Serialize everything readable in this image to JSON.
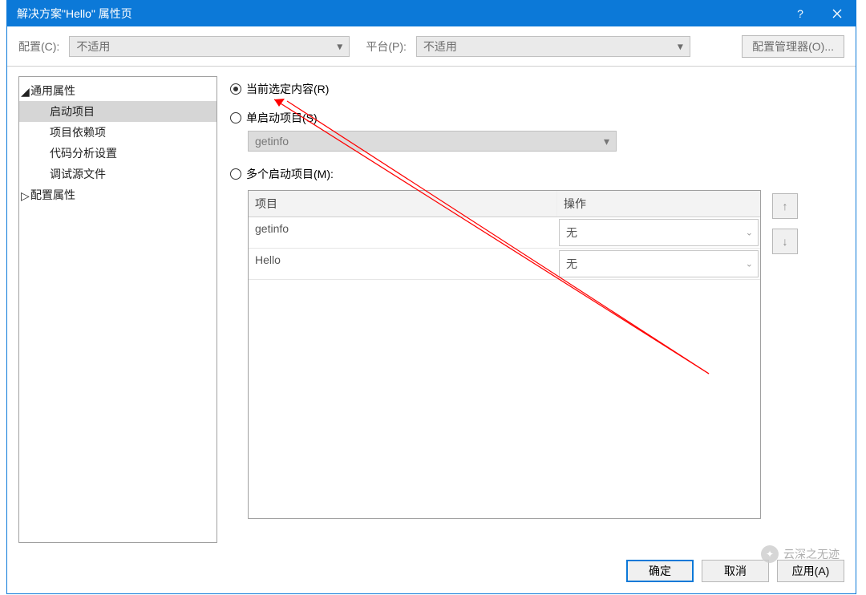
{
  "titlebar": {
    "title": "解决方案\"Hello\" 属性页"
  },
  "toprow": {
    "config_label": "配置(C):",
    "config_value": "不适用",
    "platform_label": "平台(P):",
    "platform_value": "不适用",
    "manager_button": "配置管理器(O)..."
  },
  "tree": {
    "common": "通用属性",
    "items": [
      "启动项目",
      "项目依赖项",
      "代码分析设置",
      "调试源文件"
    ],
    "config": "配置属性"
  },
  "content": {
    "radio_current": "当前选定内容(R)",
    "radio_single": "单启动项目(S)",
    "single_value": "getinfo",
    "radio_multi": "多个启动项目(M):",
    "grid": {
      "headers": {
        "project": "项目",
        "action": "操作"
      },
      "rows": [
        {
          "project": "getinfo",
          "action": "无"
        },
        {
          "project": "Hello",
          "action": "无"
        }
      ]
    }
  },
  "footer": {
    "ok": "确定",
    "cancel": "取消",
    "apply": "应用(A)"
  },
  "watermark": "云深之无迹"
}
